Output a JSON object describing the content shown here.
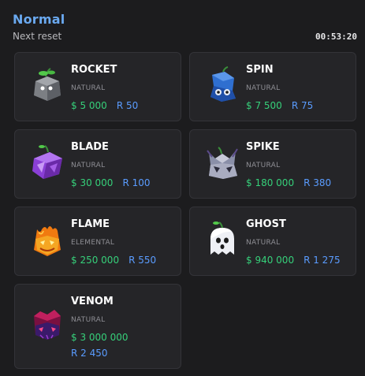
{
  "header": {
    "title": "Normal",
    "reset_label": "Next reset",
    "timer": "00:53:20"
  },
  "fruits": [
    {
      "name": "ROCKET",
      "type": "NATURAL",
      "beli": "$ 5 000",
      "robux": "R 50",
      "icon": "rocket-fruit-icon"
    },
    {
      "name": "SPIN",
      "type": "NATURAL",
      "beli": "$ 7 500",
      "robux": "R 75",
      "icon": "spin-fruit-icon"
    },
    {
      "name": "BLADE",
      "type": "NATURAL",
      "beli": "$ 30 000",
      "robux": "R 100",
      "icon": "blade-fruit-icon"
    },
    {
      "name": "SPIKE",
      "type": "NATURAL",
      "beli": "$ 180 000",
      "robux": "R 380",
      "icon": "spike-fruit-icon"
    },
    {
      "name": "FLAME",
      "type": "ELEMENTAL",
      "beli": "$ 250 000",
      "robux": "R 550",
      "icon": "flame-fruit-icon"
    },
    {
      "name": "GHOST",
      "type": "NATURAL",
      "beli": "$ 940 000",
      "robux": "R 1 275",
      "icon": "ghost-fruit-icon"
    },
    {
      "name": "VENOM",
      "type": "NATURAL",
      "beli": "$ 3 000 000",
      "robux": "R 2 450",
      "icon": "venom-fruit-icon"
    }
  ],
  "colors": {
    "title": "#6aa9f0",
    "beli": "#36d07a",
    "robux": "#5a9cff",
    "background": "#1c1c1e",
    "card": "#252528"
  }
}
